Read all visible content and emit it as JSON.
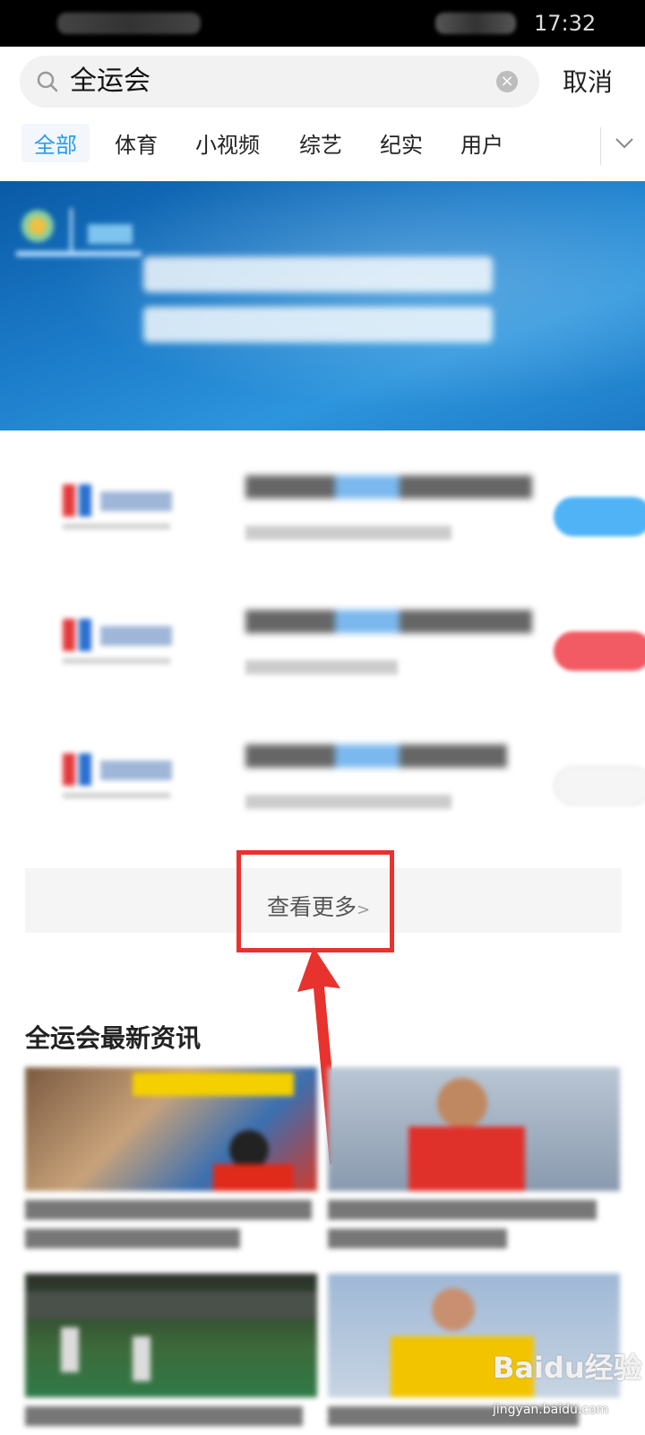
{
  "status_bar": {
    "time": "17:32"
  },
  "search": {
    "query": "全运会",
    "cancel_label": "取消"
  },
  "tabs": [
    {
      "label": "全部",
      "active": true
    },
    {
      "label": "体育"
    },
    {
      "label": "小视频"
    },
    {
      "label": "综艺"
    },
    {
      "label": "纪实"
    },
    {
      "label": "用户"
    }
  ],
  "see_more_label": "查看更多",
  "see_more_chevron": ">",
  "news_section": {
    "heading": "全运会最新资讯"
  },
  "colors": {
    "accent": "#2a9bf0",
    "highlight": "#e8322e",
    "action_blue": "#4fb3f6",
    "action_red": "#f25a64"
  },
  "watermark": {
    "logo": "Baidu经验",
    "url": "jingyan.baidu.com"
  }
}
